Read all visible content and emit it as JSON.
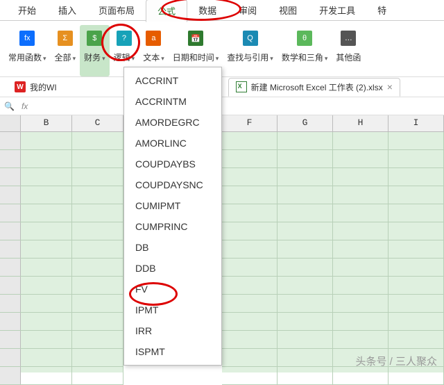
{
  "menu": {
    "items": [
      "开始",
      "插入",
      "页面布局",
      "公式",
      "数据",
      "审阅",
      "视图",
      "开发工具",
      "特"
    ],
    "active_index": 3
  },
  "ribbon": {
    "groups": [
      {
        "label": "常用函数",
        "caret": true,
        "color": "#0d6efd",
        "glyph": "fx"
      },
      {
        "label": "全部",
        "caret": true,
        "color": "#e69020",
        "glyph": "Σ"
      },
      {
        "label": "财务",
        "caret": true,
        "color": "#4aa34a",
        "glyph": "$",
        "active": true
      },
      {
        "label": "逻辑",
        "caret": true,
        "color": "#17a2b8",
        "glyph": "?"
      },
      {
        "label": "文本",
        "caret": true,
        "color": "#e65c00",
        "glyph": "a"
      },
      {
        "label": "日期和时间",
        "caret": true,
        "color": "#2f7a2f",
        "glyph": "📅"
      },
      {
        "label": "查找与引用",
        "caret": true,
        "color": "#1b8ab3",
        "glyph": "Q"
      },
      {
        "label": "数学和三角",
        "caret": true,
        "color": "#5bb85b",
        "glyph": "θ"
      },
      {
        "label": "其他函",
        "caret": false,
        "color": "#555",
        "glyph": "…"
      }
    ]
  },
  "doc_tabs": {
    "left": {
      "label": "我的WI"
    },
    "active": {
      "label": "新建 Microsoft Excel 工作表 (2).xlsx",
      "close": "×"
    }
  },
  "formula_bar": {
    "fx": "fx"
  },
  "columns": {
    "left": [
      "B",
      "C"
    ],
    "right": [
      "F",
      "G",
      "H",
      "I"
    ]
  },
  "dropdown": {
    "items": [
      "ACCRINT",
      "ACCRINTM",
      "AMORDEGRC",
      "AMORLINC",
      "COUPDAYBS",
      "COUPDAYSNC",
      "CUMIPMT",
      "CUMPRINC",
      "DB",
      "DDB",
      "FV",
      "IPMT",
      "IRR",
      "ISPMT"
    ]
  },
  "watermark": "头条号 / 三人聚众"
}
